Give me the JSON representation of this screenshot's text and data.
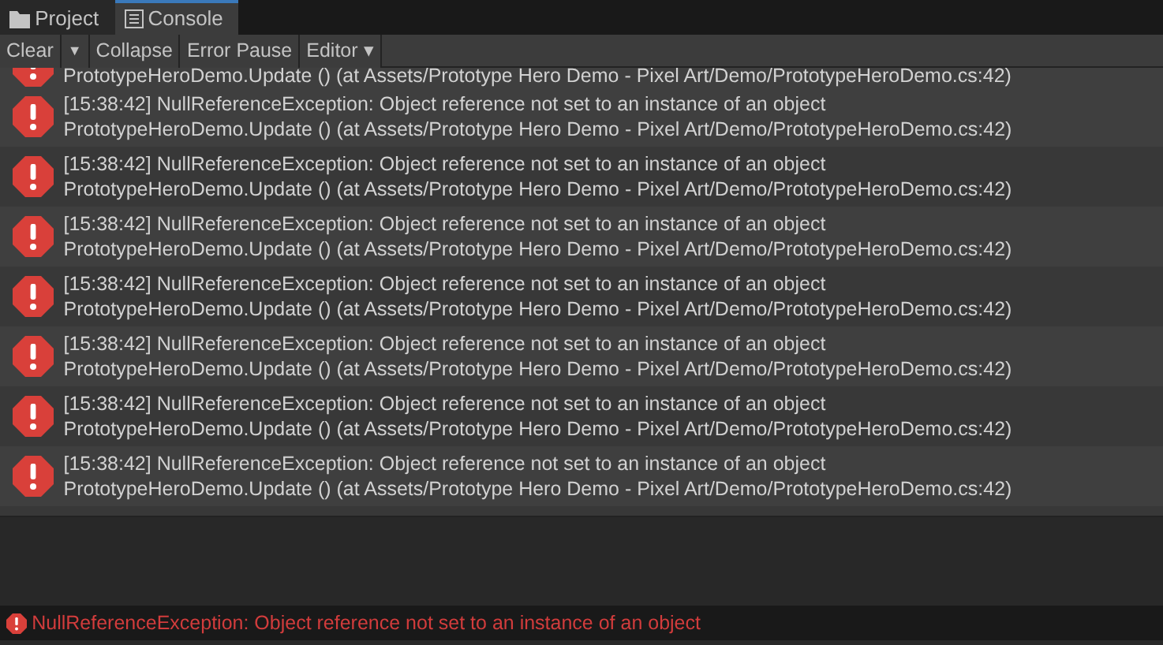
{
  "tabs": [
    {
      "label": "Project",
      "kind": "folder",
      "selected": false
    },
    {
      "label": "Console",
      "kind": "console",
      "selected": true
    }
  ],
  "toolbar": [
    {
      "label": "Clear",
      "kind": "button"
    },
    {
      "label": "▼",
      "kind": "dropdown-arrow"
    },
    {
      "label": "Collapse",
      "kind": "button"
    },
    {
      "label": "Error Pause",
      "kind": "button"
    },
    {
      "label": "Editor ▾",
      "kind": "dropdown"
    }
  ],
  "log_partial_line": "PrototypeHeroDemo.Update () (at Assets/Prototype Hero Demo - Pixel Art/Demo/PrototypeHeroDemo.cs:42)",
  "log_entries": [
    {
      "message": "[15:38:42] NullReferenceException: Object reference not set to an instance of an object",
      "trace": "PrototypeHeroDemo.Update () (at Assets/Prototype Hero Demo - Pixel Art/Demo/PrototypeHeroDemo.cs:42)"
    },
    {
      "message": "[15:38:42] NullReferenceException: Object reference not set to an instance of an object",
      "trace": "PrototypeHeroDemo.Update () (at Assets/Prototype Hero Demo - Pixel Art/Demo/PrototypeHeroDemo.cs:42)"
    },
    {
      "message": "[15:38:42] NullReferenceException: Object reference not set to an instance of an object",
      "trace": "PrototypeHeroDemo.Update () (at Assets/Prototype Hero Demo - Pixel Art/Demo/PrototypeHeroDemo.cs:42)"
    },
    {
      "message": "[15:38:42] NullReferenceException: Object reference not set to an instance of an object",
      "trace": "PrototypeHeroDemo.Update () (at Assets/Prototype Hero Demo - Pixel Art/Demo/PrototypeHeroDemo.cs:42)"
    },
    {
      "message": "[15:38:42] NullReferenceException: Object reference not set to an instance of an object",
      "trace": "PrototypeHeroDemo.Update () (at Assets/Prototype Hero Demo - Pixel Art/Demo/PrototypeHeroDemo.cs:42)"
    },
    {
      "message": "[15:38:42] NullReferenceException: Object reference not set to an instance of an object",
      "trace": "PrototypeHeroDemo.Update () (at Assets/Prototype Hero Demo - Pixel Art/Demo/PrototypeHeroDemo.cs:42)"
    },
    {
      "message": "[15:38:42] NullReferenceException: Object reference not set to an instance of an object",
      "trace": "PrototypeHeroDemo.Update () (at Assets/Prototype Hero Demo - Pixel Art/Demo/PrototypeHeroDemo.cs:42)"
    }
  ],
  "status_bar": "NullReferenceException: Object reference not set to an instance of an object"
}
